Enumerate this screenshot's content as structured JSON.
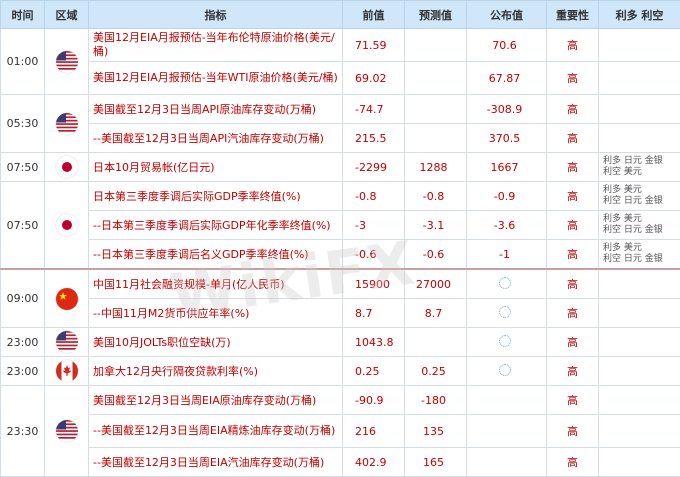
{
  "headers": {
    "time": "时间",
    "region": "区域",
    "indicator": "指标",
    "prev": "前值",
    "forecast": "预测值",
    "actual": "公布值",
    "importance": "重要性",
    "effect": "利多 利空"
  },
  "importance_label": "高",
  "groups": [
    {
      "time": "01:00",
      "flag": "us-flag-icon",
      "rows": [
        {
          "name": "美国12月EIA月报预估-当年布伦特原油价格(美元/桶)",
          "prev": "71.59",
          "forecast": "",
          "actual": "70.6",
          "effect": []
        },
        {
          "name": "美国12月EIA月报预估-当年WTI原油价格(美元/桶)",
          "prev": "69.02",
          "forecast": "",
          "actual": "67.87",
          "effect": []
        }
      ]
    },
    {
      "time": "05:30",
      "flag": "us-flag-icon",
      "rows": [
        {
          "name": "美国截至12月3日当周API原油库存变动(万桶)",
          "prev": "-74.7",
          "forecast": "",
          "actual": "-308.9",
          "effect": []
        },
        {
          "name": "--美国截至12月3日当周API汽油库存变动(万桶)",
          "prev": "215.5",
          "forecast": "",
          "actual": "370.5",
          "effect": []
        }
      ]
    },
    {
      "time": "07:50",
      "flag": "japan-flag-icon",
      "rows": [
        {
          "name": "日本10月贸易帐(亿日元)",
          "prev": "-2299",
          "forecast": "1288",
          "actual": "1667",
          "effect": [
            "利多 日元 金银",
            "利空 美元"
          ]
        }
      ]
    },
    {
      "time": "07:50",
      "flag": "japan-flag-icon",
      "rows": [
        {
          "name": "日本第三季度季调后实际GDP季率终值(%)",
          "prev": "-0.8",
          "forecast": "-0.8",
          "actual": "-0.9",
          "effect": [
            "利多 美元",
            "利空 日元 金银"
          ]
        },
        {
          "name": "--日本第三季度季调后实际GDP年化季率终值(%)",
          "prev": "-3",
          "forecast": "-3.1",
          "actual": "-3.6",
          "effect": [
            "利多 美元",
            "利空 日元 金银"
          ]
        },
        {
          "name": "--日本第三季度季调后名义GDP季率终值(%)",
          "prev": "-0.6",
          "forecast": "-0.6",
          "actual": "-1",
          "effect": [
            "利多 美元",
            "利空 日元 金银"
          ]
        }
      ]
    },
    {
      "time": "09:00",
      "flag": "china-flag-icon",
      "sep": true,
      "rows": [
        {
          "name": "中国11月社会融资规模-单月(亿人民币)",
          "prev": "15900",
          "forecast": "27000",
          "actual": "",
          "pending": true,
          "effect": []
        },
        {
          "name": "--中国11月M2货币供应年率(%)",
          "prev": "8.7",
          "forecast": "8.7",
          "actual": "",
          "pending": true,
          "effect": []
        }
      ]
    },
    {
      "time": "23:00",
      "flag": "us-flag-icon",
      "rows": [
        {
          "name": "美国10月JOLTs职位空缺(万)",
          "prev": "1043.8",
          "forecast": "",
          "actual": "",
          "pending": true,
          "effect": []
        }
      ]
    },
    {
      "time": "23:00",
      "flag": "canada-flag-icon",
      "rows": [
        {
          "name": "加拿大12月央行隔夜贷款利率(%)",
          "prev": "0.25",
          "forecast": "0.25",
          "actual": "",
          "pending": true,
          "effect": []
        }
      ]
    },
    {
      "time": "23:30",
      "flag": "us-flag-icon",
      "rows": [
        {
          "name": "美国截至12月3日当周EIA原油库存变动(万桶)",
          "prev": "-90.9",
          "forecast": "-180",
          "actual": "",
          "effect": []
        },
        {
          "name": "--美国截至12月3日当周EIA精炼油库存变动(万桶)",
          "prev": "216",
          "forecast": "135",
          "actual": "",
          "effect": []
        },
        {
          "name": "--美国截至12月3日当周EIA汽油库存变动(万桶)",
          "prev": "402.9",
          "forecast": "165",
          "actual": "",
          "effect": []
        }
      ]
    }
  ]
}
